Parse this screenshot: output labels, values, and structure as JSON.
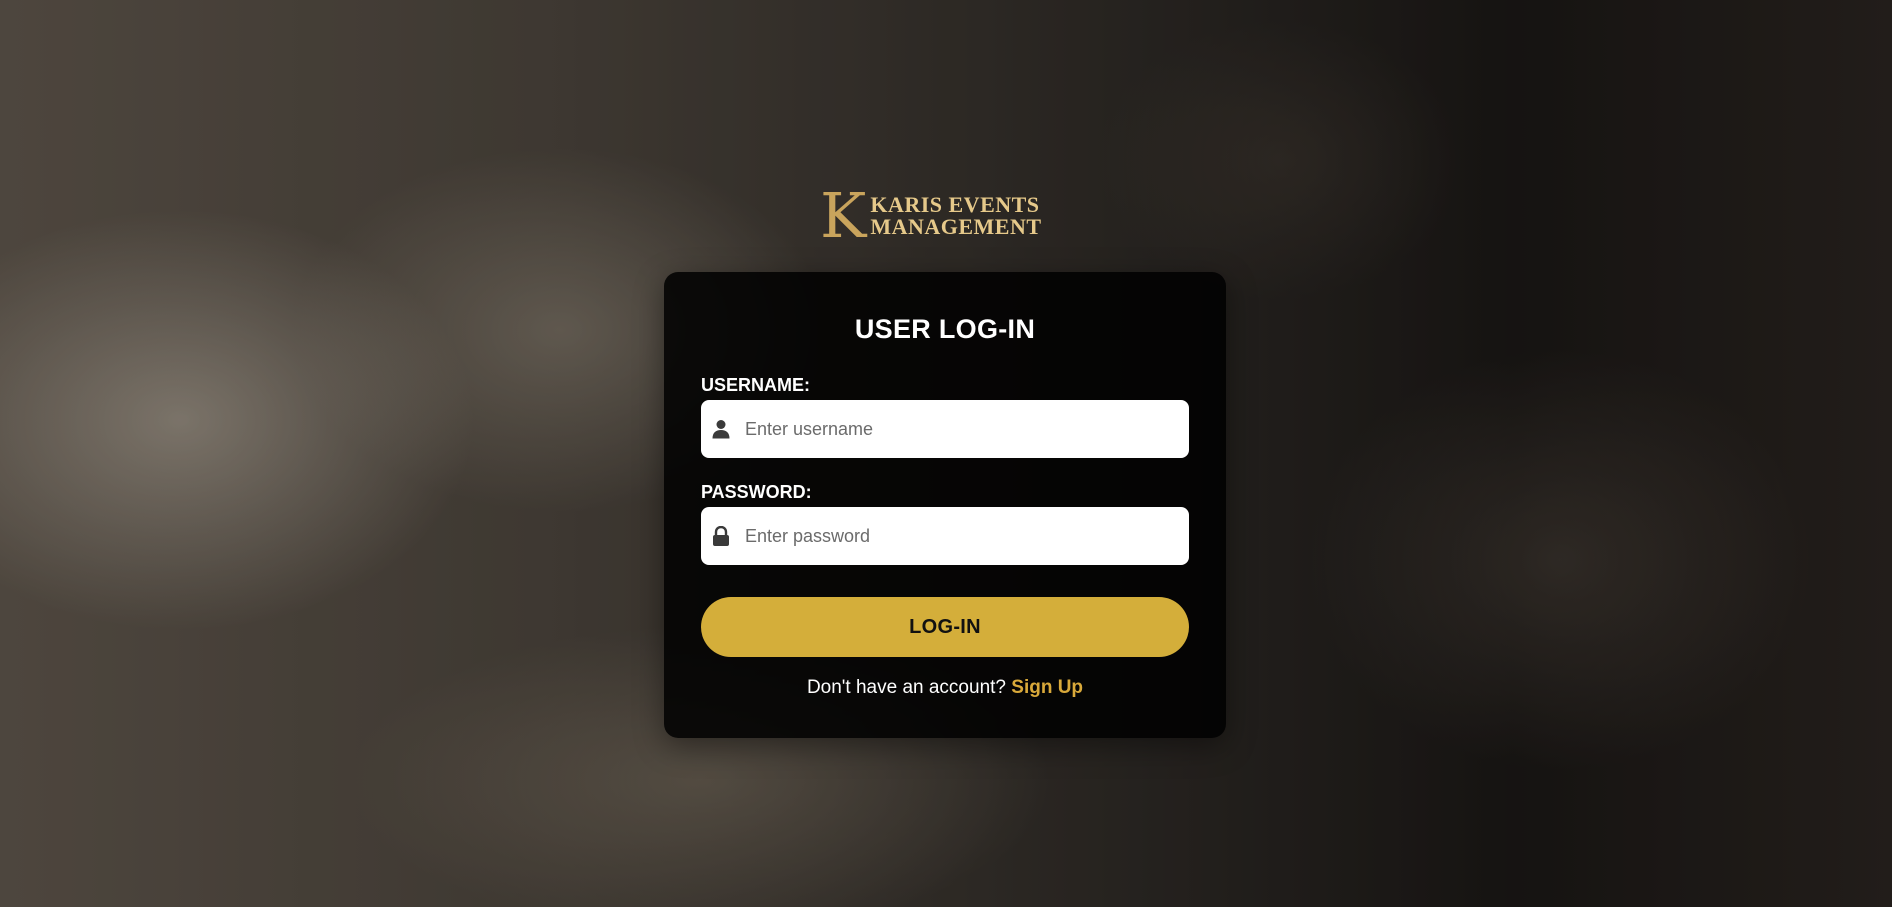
{
  "brand": {
    "logo_letter": "K",
    "logo_line1": "KARIS EVENTS",
    "logo_line2": "MANAGEMENT",
    "accent_color": "#d4ae3a"
  },
  "login": {
    "title": "USER LOG-IN",
    "username": {
      "label": "USERNAME:",
      "placeholder": "Enter username",
      "value": "",
      "icon": "user-icon"
    },
    "password": {
      "label": "PASSWORD:",
      "placeholder": "Enter password",
      "value": "",
      "icon": "lock-icon"
    },
    "submit_label": "LOG-IN",
    "signup_prompt": "Don't have an account?",
    "signup_link": "Sign Up"
  }
}
